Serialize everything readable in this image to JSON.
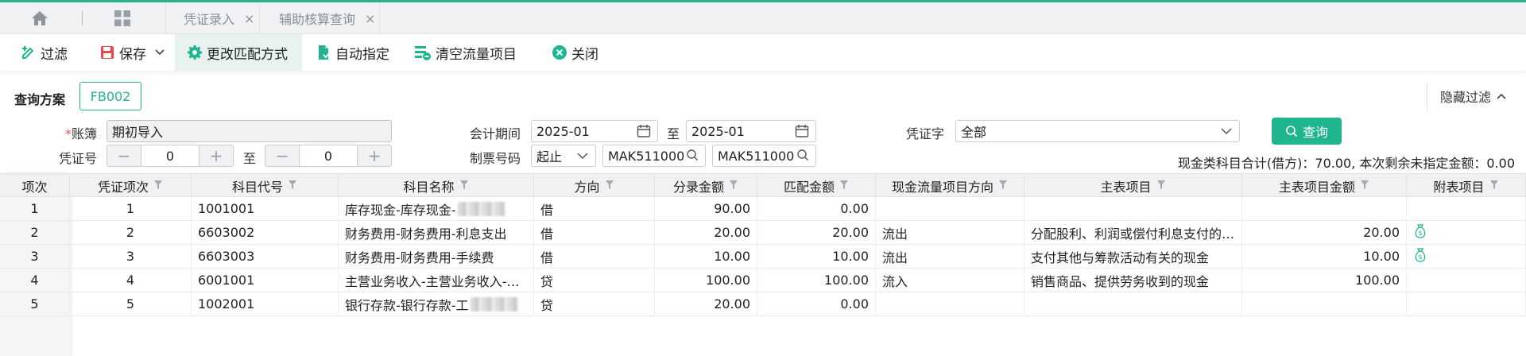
{
  "tabs": [
    {
      "label": "凭证录入",
      "close": "×"
    },
    {
      "label": "辅助核算查询",
      "close": "×"
    }
  ],
  "toolbar": {
    "filter": "过滤",
    "save": "保存",
    "change_match": "更改匹配方式",
    "auto_assign": "自动指定",
    "clear_items": "清空流量项目",
    "close": "关闭"
  },
  "scheme": {
    "label": "查询方案",
    "chip": "FB002",
    "hide_filter": "隐藏过滤"
  },
  "form": {
    "book_label": "账簿",
    "book_required": "*",
    "book_value": "期初导入",
    "voucher_no_label": "凭证号",
    "voucher_from": "0",
    "voucher_to": "0",
    "to_text": "至",
    "minus": "−",
    "plus": "+",
    "period_label": "会计期间",
    "period_from": "2025-01",
    "period_to": "2025-01",
    "invoice_label": "制票号码",
    "invoice_mode": "起止",
    "invoice_from": "MAK511000",
    "invoice_to": "MAK511000",
    "voucher_word_label": "凭证字",
    "voucher_word_value": "全部",
    "query_button": "查询"
  },
  "summary": "现金类科目合计(借方)：70.00, 本次剩余未指定金额：0.00",
  "table": {
    "headers": [
      "项次",
      "凭证项次",
      "科目代号",
      "科目名称",
      "方向",
      "分录金额",
      "匹配金额",
      "现金流量项目方向",
      "主表项目",
      "主表项目金额",
      "附表项目"
    ],
    "rows": [
      {
        "idx": "1",
        "seq": "1",
        "code": "1001001",
        "name": "库存现金-库存现金-",
        "blurred": true,
        "dir": "借",
        "amount": "90.00",
        "match": "0.00",
        "flow": "",
        "main": "",
        "main_amount": "",
        "sub": false
      },
      {
        "idx": "2",
        "seq": "2",
        "code": "6603002",
        "name": "财务费用-财务费用-利息支出",
        "blurred": false,
        "dir": "借",
        "amount": "20.00",
        "match": "20.00",
        "flow": "流出",
        "main": "分配股利、利润或偿付利息支付的…",
        "main_amount": "20.00",
        "sub": true
      },
      {
        "idx": "3",
        "seq": "3",
        "code": "6603003",
        "name": "财务费用-财务费用-手续费",
        "blurred": false,
        "dir": "借",
        "amount": "10.00",
        "match": "10.00",
        "flow": "流出",
        "main": "支付其他与筹款活动有关的现金",
        "main_amount": "10.00",
        "sub": true
      },
      {
        "idx": "4",
        "seq": "4",
        "code": "6001001",
        "name": "主营业务收入-主营业务收入-…",
        "blurred": false,
        "dir": "贷",
        "amount": "100.00",
        "match": "100.00",
        "flow": "流入",
        "main": "销售商品、提供劳务收到的现金",
        "main_amount": "100.00",
        "sub": false
      },
      {
        "idx": "5",
        "seq": "5",
        "code": "1002001",
        "name": "银行存款-银行存款-工",
        "blurred": true,
        "dir": "贷",
        "amount": "20.00",
        "match": "0.00",
        "flow": "",
        "main": "",
        "main_amount": "",
        "sub": false
      }
    ]
  },
  "colors": {
    "accent": "#25b58d",
    "query_button": "#1fb58f",
    "save_icon": "#e5484d",
    "close_icon": "#1fb58f"
  }
}
